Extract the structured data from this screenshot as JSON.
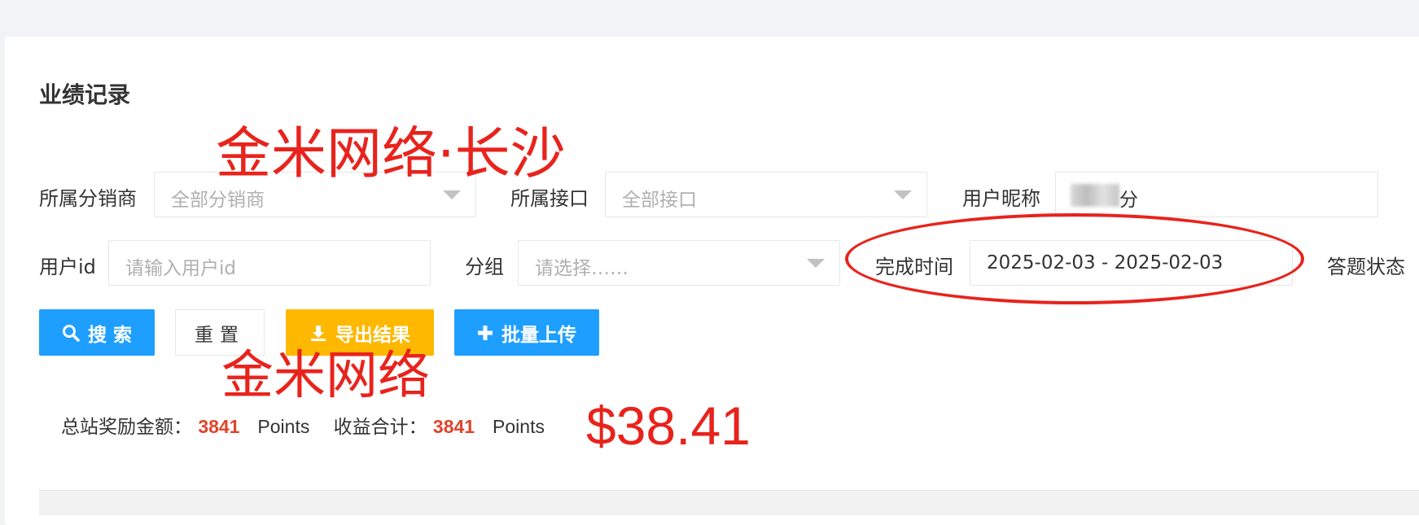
{
  "section_title": "业绩记录",
  "filters": {
    "distributor": {
      "label": "所属分销商",
      "placeholder": "全部分销商"
    },
    "interface": {
      "label": "所属接口",
      "placeholder": "全部接口"
    },
    "nickname": {
      "label": "用户昵称",
      "value": "分"
    },
    "user_id": {
      "label": "用户id",
      "placeholder": "请输入用户id"
    },
    "group": {
      "label": "分组",
      "placeholder": "请选择……"
    },
    "finish_time": {
      "label": "完成时间",
      "value": "2025-02-03 - 2025-02-03"
    },
    "answer_status": {
      "label": "答题状态"
    }
  },
  "buttons": {
    "search": "搜 索",
    "reset": "重置",
    "export": "导出结果",
    "batch_upload": "批量上传"
  },
  "stats": {
    "reward_label": "总站奖励金额：",
    "reward_value": "3841",
    "reward_unit": "Points",
    "income_label": "收益合计：",
    "income_value": "3841",
    "income_unit": "Points"
  },
  "annotations": {
    "watermark_top": "金米网络·长沙",
    "watermark_mid": "金米网络",
    "amount": "$38.41",
    "color": "#e8231c"
  },
  "icons": {
    "search": "search-icon",
    "export": "download-icon",
    "upload": "plus-icon",
    "select_caret": "caret-down-icon"
  }
}
